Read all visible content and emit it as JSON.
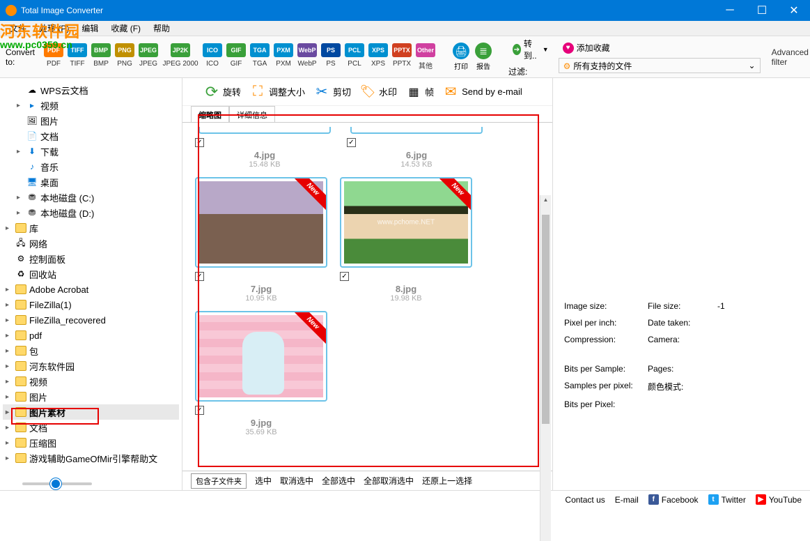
{
  "window": {
    "title": "Total Image Converter"
  },
  "menus": [
    "文件",
    "处理 (P)",
    "编辑",
    "收藏 (F)",
    "帮助"
  ],
  "toolbar": {
    "convert_to": "Convert to:",
    "formats": [
      {
        "id": "PDF",
        "label": "PDF",
        "color": "#ff7a00"
      },
      {
        "id": "TIFF",
        "label": "TIFF",
        "color": "#0090d0"
      },
      {
        "id": "BMP",
        "label": "BMP",
        "color": "#3aa03a"
      },
      {
        "id": "PNG",
        "label": "PNG",
        "color": "#c09000"
      },
      {
        "id": "JPEG",
        "label": "JPEG",
        "color": "#3aa03a"
      },
      {
        "id": "JP2K",
        "label": "JPEG 2000",
        "color": "#3aa03a",
        "wide": true
      },
      {
        "id": "ICO",
        "label": "ICO",
        "color": "#0090d0"
      },
      {
        "id": "GIF",
        "label": "GIF",
        "color": "#3aa03a"
      },
      {
        "id": "TGA",
        "label": "TGA",
        "color": "#0090d0"
      },
      {
        "id": "PXM",
        "label": "PXM",
        "color": "#0090d0"
      },
      {
        "id": "WebP",
        "label": "WebP",
        "color": "#6a4aa0"
      },
      {
        "id": "PS",
        "label": "PS",
        "color": "#0048a0"
      },
      {
        "id": "PCL",
        "label": "PCL",
        "color": "#0090d0"
      },
      {
        "id": "XPS",
        "label": "XPS",
        "color": "#0090d0"
      },
      {
        "id": "PPTX",
        "label": "PPTX",
        "color": "#d04020"
      },
      {
        "id": "Other",
        "label": "其他",
        "color": "#d040a0"
      }
    ],
    "print": "打印",
    "report": "报告",
    "goto": "转到..",
    "favorite": "添加收藏",
    "filter_label": "过滤:",
    "filter_value": "所有支持的文件",
    "advanced_filter": "Advanced filter"
  },
  "edit_toolbar": {
    "rotate": "旋转",
    "resize": "调整大小",
    "crop": "剪切",
    "watermark": "水印",
    "frame": "帧",
    "send_email": "Send by e-mail"
  },
  "tree": {
    "items": [
      {
        "depth": 1,
        "tw": "",
        "icon": "cloud",
        "label": "WPS云文档"
      },
      {
        "depth": 1,
        "tw": "▸",
        "icon": "video",
        "label": "视频",
        "color": "#0078d7"
      },
      {
        "depth": 1,
        "tw": "",
        "icon": "pic",
        "label": "图片"
      },
      {
        "depth": 1,
        "tw": "",
        "icon": "doc",
        "label": "文档",
        "color": "#0078d7"
      },
      {
        "depth": 1,
        "tw": "▸",
        "icon": "down",
        "label": "下载",
        "color": "#0078d7"
      },
      {
        "depth": 1,
        "tw": "",
        "icon": "music",
        "label": "音乐",
        "color": "#0078d7"
      },
      {
        "depth": 1,
        "tw": "",
        "icon": "desk",
        "label": "桌面",
        "color": "#0078d7"
      },
      {
        "depth": 1,
        "tw": "▸",
        "icon": "disk",
        "label": "本地磁盘 (C:)"
      },
      {
        "depth": 1,
        "tw": "▸",
        "icon": "disk",
        "label": "本地磁盘 (D:)"
      },
      {
        "depth": 0,
        "tw": "▸",
        "icon": "folder",
        "label": "库"
      },
      {
        "depth": 0,
        "tw": "",
        "icon": "net",
        "label": "网络"
      },
      {
        "depth": 0,
        "tw": "",
        "icon": "ctrl",
        "label": "控制面板"
      },
      {
        "depth": 0,
        "tw": "",
        "icon": "recyc",
        "label": "回收站"
      },
      {
        "depth": 0,
        "tw": "▸",
        "icon": "folder",
        "label": "Adobe Acrobat"
      },
      {
        "depth": 0,
        "tw": "▸",
        "icon": "folder",
        "label": "FileZilla(1)"
      },
      {
        "depth": 0,
        "tw": "▸",
        "icon": "folder",
        "label": "FileZilla_recovered"
      },
      {
        "depth": 0,
        "tw": "▸",
        "icon": "folder",
        "label": "pdf"
      },
      {
        "depth": 0,
        "tw": "▸",
        "icon": "folder",
        "label": "包"
      },
      {
        "depth": 0,
        "tw": "▸",
        "icon": "folder",
        "label": "河东软件园"
      },
      {
        "depth": 0,
        "tw": "▸",
        "icon": "folder",
        "label": "视频"
      },
      {
        "depth": 0,
        "tw": "▸",
        "icon": "folder",
        "label": "图片"
      },
      {
        "depth": 0,
        "tw": "▸",
        "icon": "folder",
        "label": "图片素材",
        "selected": true
      },
      {
        "depth": 0,
        "tw": "▸",
        "icon": "folder",
        "label": "文档"
      },
      {
        "depth": 0,
        "tw": "▸",
        "icon": "folder",
        "label": "压缩图"
      },
      {
        "depth": 0,
        "tw": "▸",
        "icon": "folder",
        "label": "游戏辅助GameOfMir引擎帮助文"
      }
    ]
  },
  "tabs": {
    "thumb": "缩略图",
    "detail": "详细信息"
  },
  "thumbs": [
    {
      "name": "4.jpg",
      "size": "15.48 KB",
      "stub": true
    },
    {
      "name": "6.jpg",
      "size": "14.53 KB",
      "stub": true
    },
    {
      "name": "7.jpg",
      "size": "10.95 KB",
      "new": true,
      "imgcls": "img-7"
    },
    {
      "name": "8.jpg",
      "size": "19.98 KB",
      "new": true,
      "imgcls": "img-8"
    },
    {
      "name": "9.jpg",
      "size": "35.69 KB",
      "new": true,
      "imgcls": "img-9"
    }
  ],
  "bottom_tabs": [
    "包含子文件夹",
    "选中",
    "取消选中",
    "全部选中",
    "全部取消选中",
    "还原上一选择"
  ],
  "info": {
    "image_size": "Image size:",
    "file_size_l": "File size:",
    "file_size_v": "-1",
    "ppi": "Pixel per inch:",
    "date_taken": "Date taken:",
    "compression": "Compression:",
    "camera": "Camera:",
    "bps": "Bits per Sample:",
    "pages": "Pages:",
    "spp": "Samples per pixel:",
    "color_mode": "颜色模式:",
    "bpp": "Bits per Pixel:"
  },
  "footer": {
    "contact": "Contact us",
    "email": "E-mail",
    "facebook": "Facebook",
    "twitter": "Twitter",
    "youtube": "YouTube"
  },
  "watermark": {
    "line1": "河东软件园",
    "line2": "www.pc0359.cn"
  }
}
